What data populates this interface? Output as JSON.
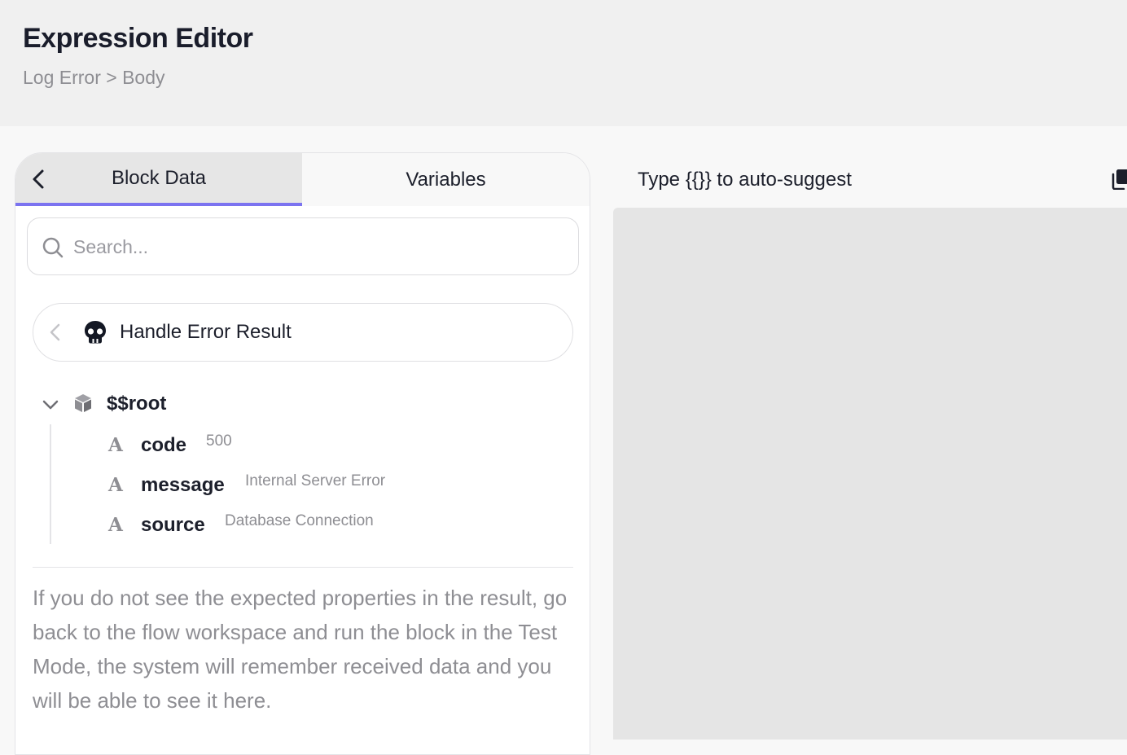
{
  "header": {
    "title": "Expression Editor",
    "breadcrumb": "Log Error > Body"
  },
  "tabs": [
    {
      "label": "Block Data",
      "active": true
    },
    {
      "label": "Variables",
      "active": false
    }
  ],
  "search": {
    "placeholder": "Search...",
    "value": ""
  },
  "source": {
    "label": "Handle Error Result",
    "icon": "skull-icon"
  },
  "tree": {
    "root_label": "$$root",
    "root_icon": "cube-icon",
    "properties": [
      {
        "key": "code",
        "value": "500",
        "icon": "text-type-icon"
      },
      {
        "key": "message",
        "value": "Internal Server Error",
        "icon": "text-type-icon"
      },
      {
        "key": "source",
        "value": "Database Connection",
        "icon": "text-type-icon"
      }
    ]
  },
  "hint": "If you do not see the expected properties in the result, go back to the flow workspace and run the block in the Test Mode, the system will remember received data and you will be able to see it here.",
  "editor": {
    "hint": "Type {{}} to auto-suggest"
  },
  "colors": {
    "accent": "#7b73f0",
    "active_tab_bg": "#e6e6e6",
    "editor_bg": "#e5e5e5",
    "muted_text": "#8e8e93"
  }
}
